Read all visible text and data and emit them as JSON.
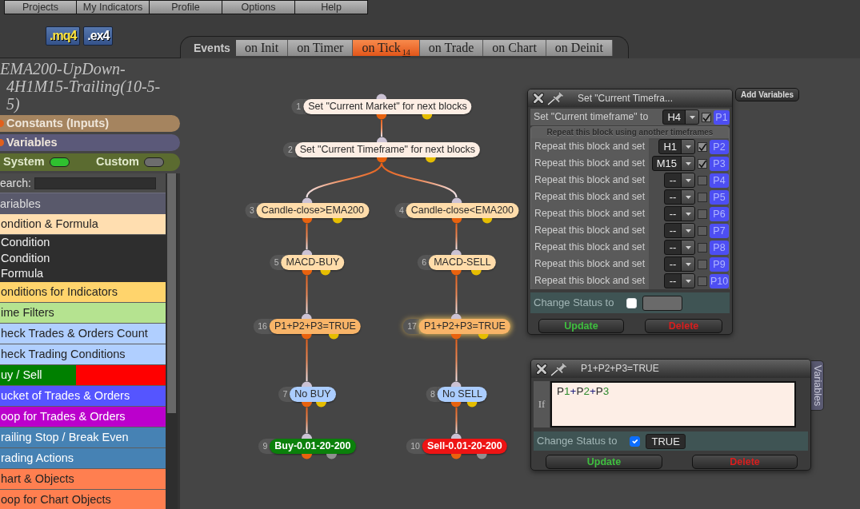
{
  "menu": [
    "Projects",
    "My Indicators",
    "Profile",
    "Options",
    "Help"
  ],
  "file_buttons": [
    {
      "label": ".mq4",
      "kind": "source"
    },
    {
      "label": ".ex4",
      "kind": "compiled"
    }
  ],
  "events": {
    "label": "Events",
    "tabs": [
      {
        "label": "on Init",
        "selected": false
      },
      {
        "label": "on Timer",
        "selected": false
      },
      {
        "label": "on Tick",
        "count": "14",
        "selected": true
      },
      {
        "label": "on Trade",
        "selected": false
      },
      {
        "label": "on Chart",
        "selected": false
      },
      {
        "label": "on Deinit",
        "selected": false
      }
    ]
  },
  "sidebar": {
    "title_lines": [
      "EMA200-UpDown-",
      "4H1M15-Trailing(10-5-",
      "5)"
    ],
    "sections": [
      {
        "label": "Constants (Inputs)",
        "color": "#a5845f"
      },
      {
        "label": "Variables",
        "color": "#5b5979"
      }
    ],
    "toggles": [
      {
        "label": "System",
        "on": true
      },
      {
        "label": "Custom",
        "on": false
      }
    ],
    "search": {
      "label": "earch:"
    },
    "list_header": "ariables",
    "categories": [
      {
        "label": "ondition & Formula",
        "color": "#ffdeb0",
        "children": [
          {
            "label": "Condition"
          },
          {
            "label": "Condition"
          },
          {
            "label": "Formula"
          }
        ]
      },
      {
        "label": "onditions for Indicators",
        "color": "#ffd46c"
      },
      {
        "label": "ime Filters",
        "color": "#b5e390"
      },
      {
        "label": "heck Trades & Orders Count",
        "color": "#b0cfff"
      },
      {
        "label": "heck Trading Conditions",
        "color": "#b0cfff"
      },
      {
        "label": "uy / Sell",
        "segments": [
          {
            "color": "#008000"
          },
          {
            "color": "#ff0000"
          }
        ]
      },
      {
        "label": "ucket of Trades & Orders",
        "color": "#5555ff"
      },
      {
        "label": "oop for Trades & Orders",
        "color": "#bb00cc"
      },
      {
        "label": "railing Stop / Break Even",
        "color": "#4682b4"
      },
      {
        "label": "rading Actions",
        "color": "#4682b4"
      },
      {
        "label": "hart & Objects",
        "color": "#ff7f50"
      },
      {
        "label": "oop for Chart Objects",
        "color": "#ff7f50"
      }
    ]
  },
  "blocks": [
    {
      "number": "1",
      "label": "Set \"Current Market\" for next blocks",
      "color": "#fdeee4",
      "kind": "standard",
      "selected": false,
      "children": [
        {
          "number": "2",
          "label": "Set \"Current Timeframe\" for next blocks",
          "color": "#fdeee4",
          "kind": "standard",
          "selected": false,
          "children": [
            {
              "number": "3",
              "label": "Candle-close>EMA200",
              "color": "#ffdcaa",
              "kind": "standard",
              "selected": false,
              "children": [
                {
                  "number": "5",
                  "label": "MACD-BUY",
                  "color": "#ffdcaa",
                  "kind": "standard",
                  "selected": false,
                  "children": [
                    {
                      "number": "16",
                      "label": "P1+P2+P3=TRUE",
                      "color": "#f8b468",
                      "kind": "standard",
                      "selected": false,
                      "children": [
                        {
                          "number": "7",
                          "label": "No BUY",
                          "color": "#abcdff",
                          "kind": "standard",
                          "selected": false,
                          "children": [
                            {
                              "number": "9",
                              "label": "Buy-0.01-20-200",
                              "color": "#0b800b",
                              "kind": "trade",
                              "selected": false
                            }
                          ]
                        }
                      ]
                    }
                  ]
                }
              ]
            },
            {
              "number": "4",
              "label": "Candle-close<EMA200",
              "color": "#ffdcaa",
              "kind": "standard",
              "selected": false,
              "children": [
                {
                  "number": "6",
                  "label": "MACD-SELL",
                  "color": "#ffdcaa",
                  "kind": "standard",
                  "selected": false,
                  "children": [
                    {
                      "number": "17",
                      "label": "P1+P2+P3=TRUE",
                      "color": "#f8b468",
                      "kind": "standard",
                      "selected": true,
                      "children": [
                        {
                          "number": "8",
                          "label": "No SELL",
                          "color": "#abcdff",
                          "kind": "standard",
                          "selected": false,
                          "children": [
                            {
                              "number": "10",
                              "label": "Sell-0.01-20-200",
                              "color": "#ee1414",
                              "kind": "trade",
                              "selected": false
                            }
                          ]
                        }
                      ]
                    }
                  ]
                }
              ]
            }
          ]
        }
      ]
    }
  ],
  "block_editor": {
    "title": "Set \"Current Timefra...",
    "add_variables": "Add Variables",
    "main_row": {
      "label": "Set \"Current timeframe\" to",
      "value": "H4",
      "checked": true,
      "param": "P1"
    },
    "repeat_header": "Repeat this block using another timeframes",
    "repeat_rows": [
      {
        "label": "Repeat this block and set",
        "value": "H1",
        "checked": true,
        "param": "P2"
      },
      {
        "label": "Repeat this block and set",
        "value": "M15",
        "checked": true,
        "param": "P3"
      },
      {
        "label": "Repeat this block and set",
        "value": "--",
        "checked": false,
        "param": "P4"
      },
      {
        "label": "Repeat this block and set",
        "value": "--",
        "checked": false,
        "param": "P5"
      },
      {
        "label": "Repeat this block and set",
        "value": "--",
        "checked": false,
        "param": "P6"
      },
      {
        "label": "Repeat this block and set",
        "value": "--",
        "checked": false,
        "param": "P7"
      },
      {
        "label": "Repeat this block and set",
        "value": "--",
        "checked": false,
        "param": "P8"
      },
      {
        "label": "Repeat this block and set",
        "value": "--",
        "checked": false,
        "param": "P9"
      },
      {
        "label": "Repeat this block and set",
        "value": "--",
        "checked": false,
        "param": "P10"
      }
    ],
    "status": {
      "label": "Change Status to",
      "checked": false
    },
    "buttons": [
      {
        "label": "Update",
        "kind": "update"
      },
      {
        "label": "Delete",
        "kind": "delete"
      }
    ]
  },
  "condition_editor": {
    "title": "P1+P2+P3=TRUE",
    "side_tab": "Variables",
    "if_label": "If",
    "formula": [
      {
        "text": "P",
        "kind": "name"
      },
      {
        "text": "1",
        "kind": "number"
      },
      {
        "text": "+",
        "kind": "operator"
      },
      {
        "text": "P",
        "kind": "name"
      },
      {
        "text": "2",
        "kind": "number"
      },
      {
        "text": "+",
        "kind": "operator"
      },
      {
        "text": "P",
        "kind": "name"
      },
      {
        "text": "3",
        "kind": "number"
      }
    ],
    "status": {
      "label": "Change Status to",
      "checked": true,
      "value": "TRUE"
    },
    "buttons": [
      {
        "label": "Update",
        "kind": "update"
      },
      {
        "label": "Delete",
        "kind": "delete"
      }
    ]
  }
}
